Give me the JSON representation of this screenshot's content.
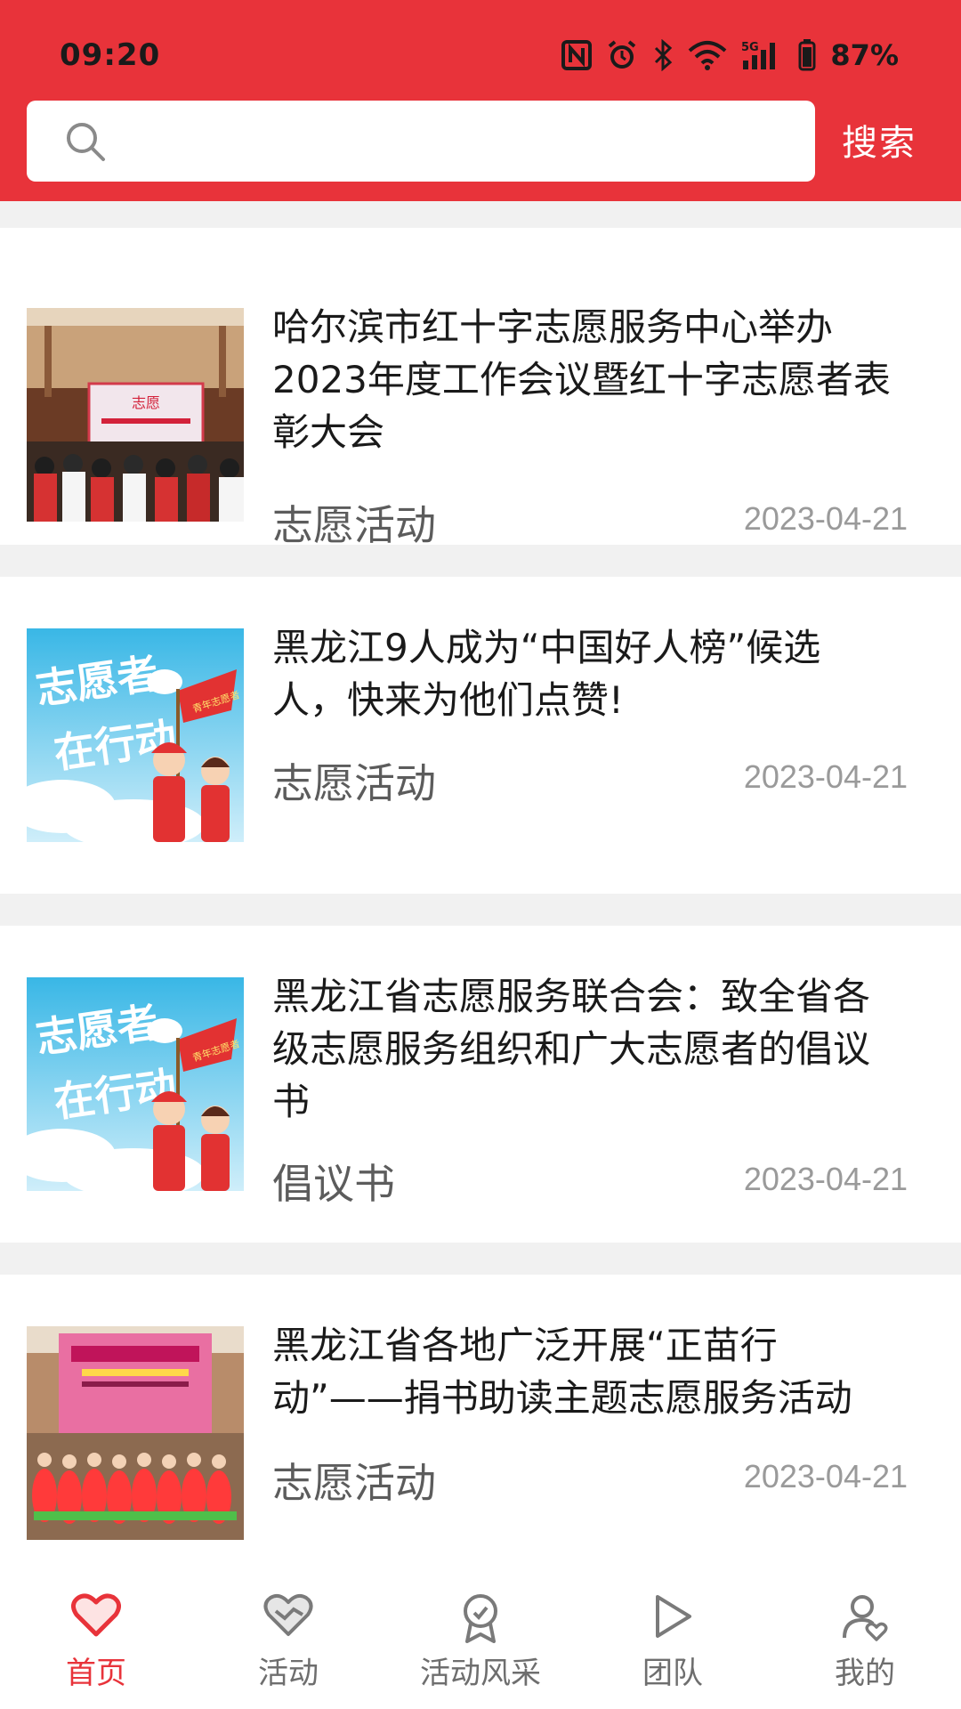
{
  "status_bar": {
    "time": "09:20",
    "icons": [
      "nfc-icon",
      "alarm-icon",
      "bluetooth-icon",
      "wifi-icon",
      "signal-5g-icon",
      "battery-icon"
    ],
    "battery": "87%"
  },
  "search": {
    "placeholder": "",
    "button_label": "搜索"
  },
  "colors": {
    "accent": "#e8333a",
    "nav_active": "#e8333a",
    "nav_inactive": "#6e6e6e"
  },
  "news": [
    {
      "title": "哈尔滨市红十字志愿服务中心举办2023年度工作会议暨红十字志愿者表彰大会",
      "category": "志愿活动",
      "date": "2023-04-21",
      "image": "conference-hall-photo"
    },
    {
      "title": "黑龙江9人成为“中国好人榜”候选人，快来为他们点赞!",
      "category": "志愿活动",
      "date": "2023-04-21",
      "image": "volunteer-action-poster"
    },
    {
      "title": "黑龙江省志愿服务联合会：致全省各级志愿服务组织和广大志愿者的倡议书",
      "category": "倡议书",
      "date": "2023-04-21",
      "image": "volunteer-action-poster"
    },
    {
      "title": "黑龙江省各地广泛开展“正苗行动”——捐书助读主题志愿服务活动",
      "category": "志愿活动",
      "date": "2023-04-21",
      "image": "stage-performance-photo"
    }
  ],
  "poster_text": {
    "line1": "志愿者",
    "line2": "在行动",
    "flag": "青年志愿者"
  },
  "nav": [
    {
      "label": "首页",
      "icon": "heart-icon",
      "active": true
    },
    {
      "label": "活动",
      "icon": "handshake-heart-icon",
      "active": false
    },
    {
      "label": "活动风采",
      "icon": "medal-icon",
      "active": false
    },
    {
      "label": "团队",
      "icon": "play-icon",
      "active": false
    },
    {
      "label": "我的",
      "icon": "user-heart-icon",
      "active": false
    }
  ]
}
